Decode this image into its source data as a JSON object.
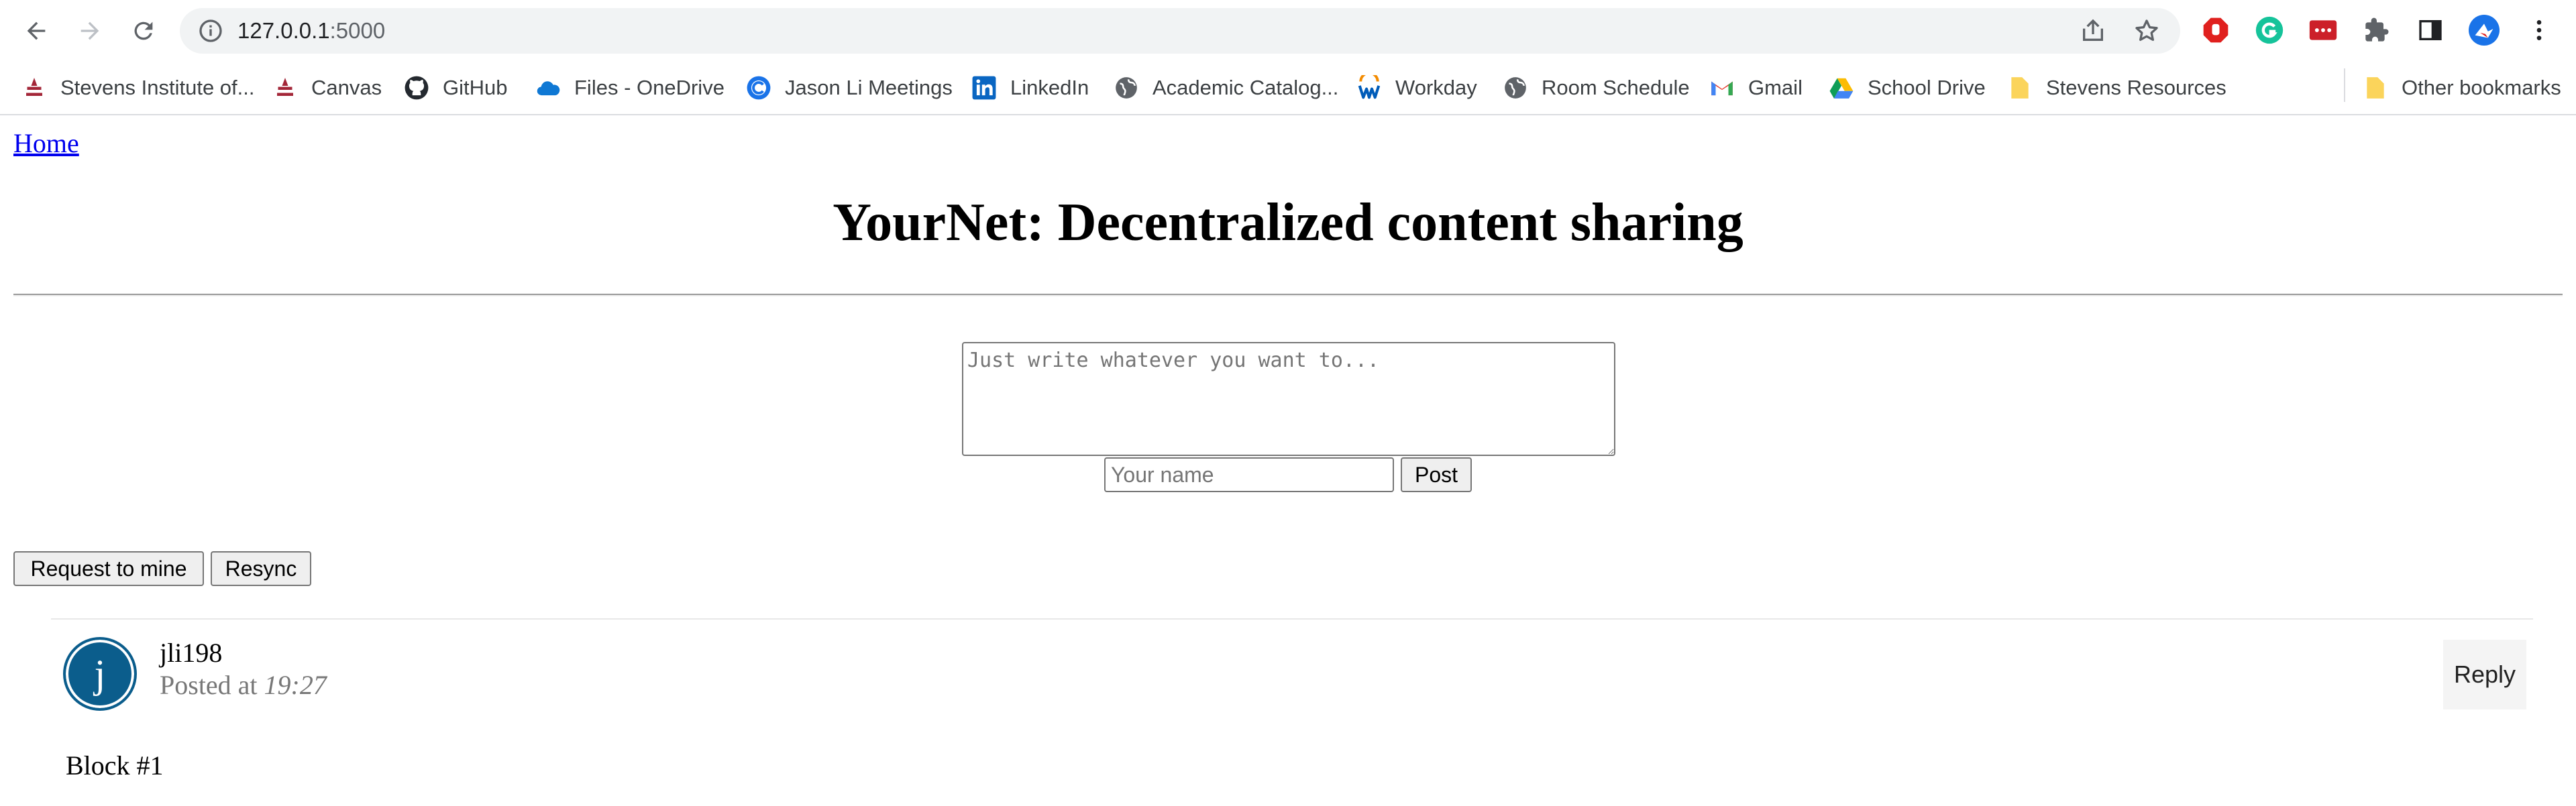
{
  "browser": {
    "url_host": "127.0.0.1",
    "url_port": ":5000"
  },
  "bookmarks": [
    {
      "label": "Stevens Institute of...",
      "icon": "stevens-icon"
    },
    {
      "label": "Canvas",
      "icon": "stevens-icon"
    },
    {
      "label": "GitHub",
      "icon": "github-icon"
    },
    {
      "label": "Files - OneDrive",
      "icon": "onedrive-icon"
    },
    {
      "label": "Jason Li Meetings",
      "icon": "calendar-icon"
    },
    {
      "label": "LinkedIn",
      "icon": "linkedin-icon"
    },
    {
      "label": "Academic Catalog...",
      "icon": "globe-icon"
    },
    {
      "label": "Workday",
      "icon": "workday-icon"
    },
    {
      "label": "Room Schedule",
      "icon": "globe-icon"
    },
    {
      "label": "Gmail",
      "icon": "gmail-icon"
    },
    {
      "label": "School Drive",
      "icon": "drive-icon"
    },
    {
      "label": "Stevens Resources",
      "icon": "folder-icon"
    }
  ],
  "other_bookmarks": "Other bookmarks",
  "page": {
    "home_link": "Home",
    "title": "YourNet: Decentralized content sharing",
    "post_placeholder": "Just write whatever you want to...",
    "name_placeholder": "Your name",
    "post_button": "Post",
    "request_button": "Request to mine",
    "resync_button": "Resync"
  },
  "post": {
    "avatar_letter": "j",
    "author": "jli198",
    "posted_prefix": "Posted at ",
    "time": "19:27",
    "reply_label": "Reply",
    "content": "Block #1"
  },
  "colors": {
    "avatar": "#0b5d8c",
    "link": "#0000ee"
  }
}
